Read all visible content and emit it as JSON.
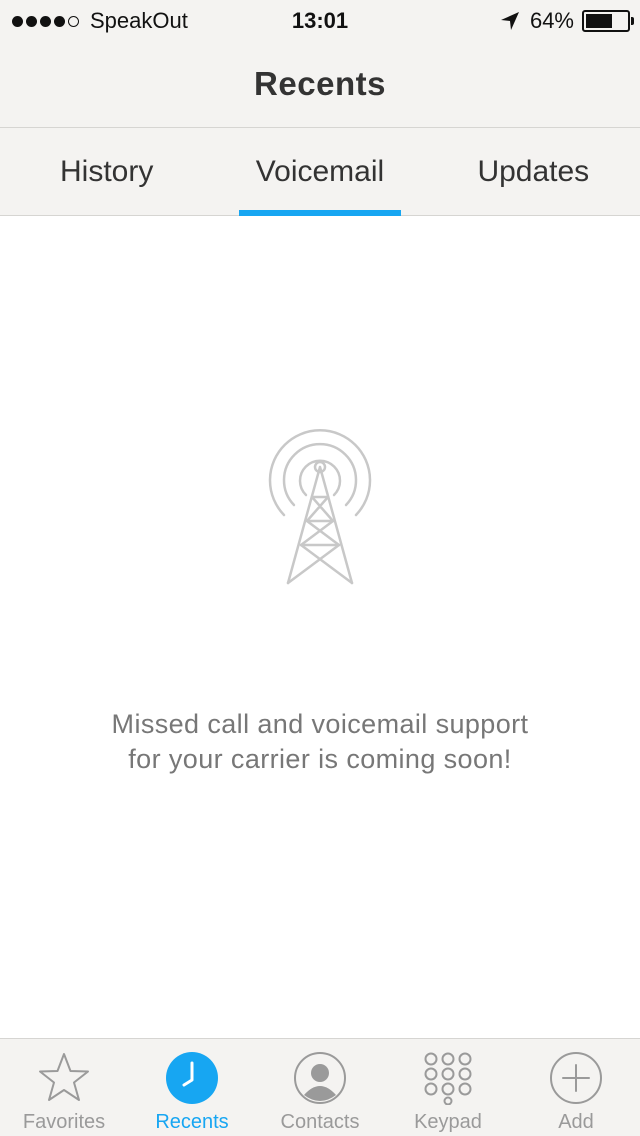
{
  "status_bar": {
    "carrier": "SpeakOut",
    "time": "13:01",
    "battery_percent": "64%",
    "signal_bars_filled": 4,
    "signal_bars_total": 5,
    "battery_level": 0.64
  },
  "nav": {
    "title": "Recents"
  },
  "tabs": [
    {
      "label": "History",
      "active": false
    },
    {
      "label": "Voicemail",
      "active": true
    },
    {
      "label": "Updates",
      "active": false
    }
  ],
  "empty_state": {
    "icon": "radio-tower-icon",
    "line1": "Missed call and voicemail support",
    "line2": "for your carrier is coming soon!"
  },
  "tab_bar": [
    {
      "label": "Favorites",
      "icon": "star-icon",
      "active": false
    },
    {
      "label": "Recents",
      "icon": "clock-icon",
      "active": true
    },
    {
      "label": "Contacts",
      "icon": "person-icon",
      "active": false
    },
    {
      "label": "Keypad",
      "icon": "keypad-icon",
      "active": false
    },
    {
      "label": "Add",
      "icon": "plus-icon",
      "active": false
    }
  ],
  "colors": {
    "accent": "#17a6f2",
    "bar_bg": "#f4f3f1",
    "muted": "#9a9a9a"
  }
}
